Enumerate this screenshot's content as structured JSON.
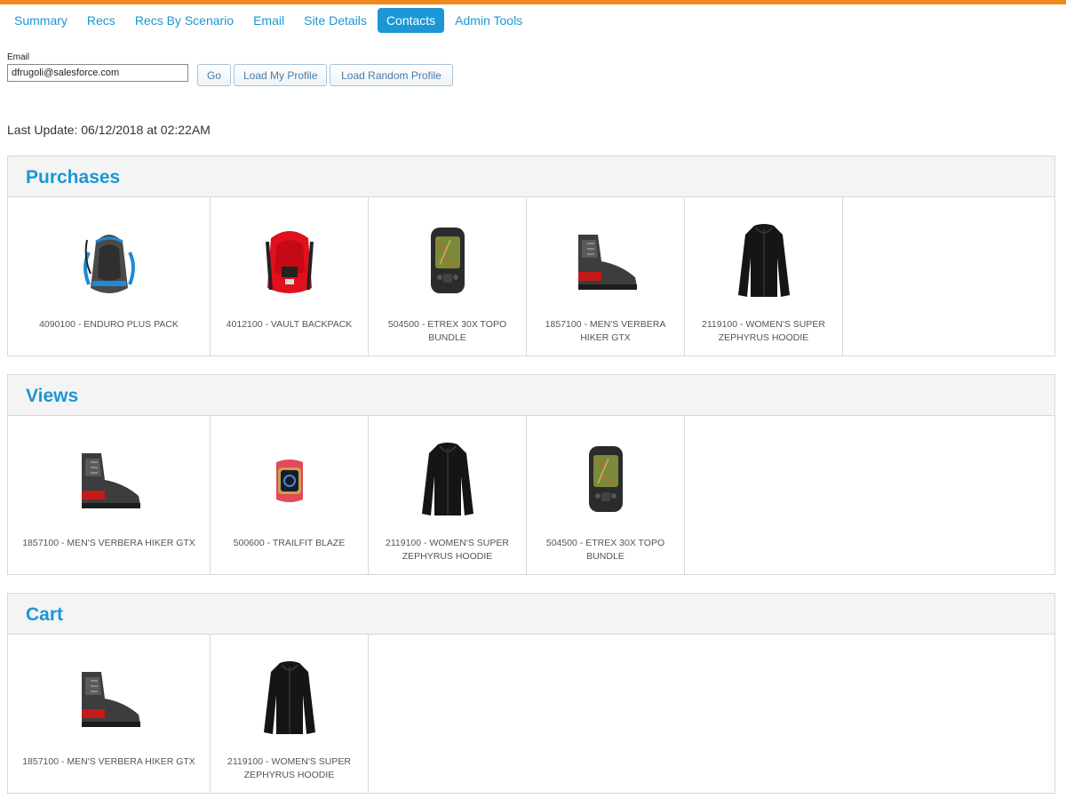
{
  "colors": {
    "accent": "#ee8a1c",
    "brand_blue": "#1b97d5",
    "active_tab_bg": "#1b97d5",
    "active_tab_text": "#ffffff"
  },
  "nav": {
    "items": [
      {
        "label": "Summary",
        "active": false
      },
      {
        "label": "Recs",
        "active": false
      },
      {
        "label": "Recs By Scenario",
        "active": false
      },
      {
        "label": "Email",
        "active": false
      },
      {
        "label": "Site Details",
        "active": false
      },
      {
        "label": "Contacts",
        "active": true
      },
      {
        "label": "Admin Tools",
        "active": false
      }
    ]
  },
  "profile_form": {
    "email_label": "Email",
    "email_value": "dfrugoli@salesforce.com",
    "go_label": "Go",
    "load_my_profile_label": "Load My Profile",
    "load_random_profile_label": "Load Random Profile"
  },
  "last_update": "Last Update: 06/12/2018 at 02:22AM",
  "sections": [
    {
      "title": "Purchases",
      "products": [
        {
          "label": "4090100 - ENDURO PLUS PACK",
          "icon": "hydration-pack-icon"
        },
        {
          "label": "4012100 - VAULT BACKPACK",
          "icon": "backpack-icon"
        },
        {
          "label": "504500 - ETREX 30X TOPO BUNDLE",
          "icon": "gps-device-icon"
        },
        {
          "label": "1857100 - MEN'S VERBERA HIKER GTX",
          "icon": "hiking-boot-icon"
        },
        {
          "label": "2119100 - WOMEN'S SUPER ZEPHYRUS HOODIE",
          "icon": "jacket-icon"
        }
      ]
    },
    {
      "title": "Views",
      "products": [
        {
          "label": "1857100 - MEN'S VERBERA HIKER GTX",
          "icon": "hiking-boot-icon"
        },
        {
          "label": "500600 - TRAILFIT BLAZE",
          "icon": "fitness-watch-icon"
        },
        {
          "label": "2119100 - WOMEN'S SUPER ZEPHYRUS HOODIE",
          "icon": "jacket-icon"
        },
        {
          "label": "504500 - ETREX 30X TOPO BUNDLE",
          "icon": "gps-device-icon"
        }
      ]
    },
    {
      "title": "Cart",
      "products": [
        {
          "label": "1857100 - MEN'S VERBERA HIKER GTX",
          "icon": "hiking-boot-icon"
        },
        {
          "label": "2119100 - WOMEN'S SUPER ZEPHYRUS HOODIE",
          "icon": "jacket-icon"
        }
      ]
    }
  ]
}
